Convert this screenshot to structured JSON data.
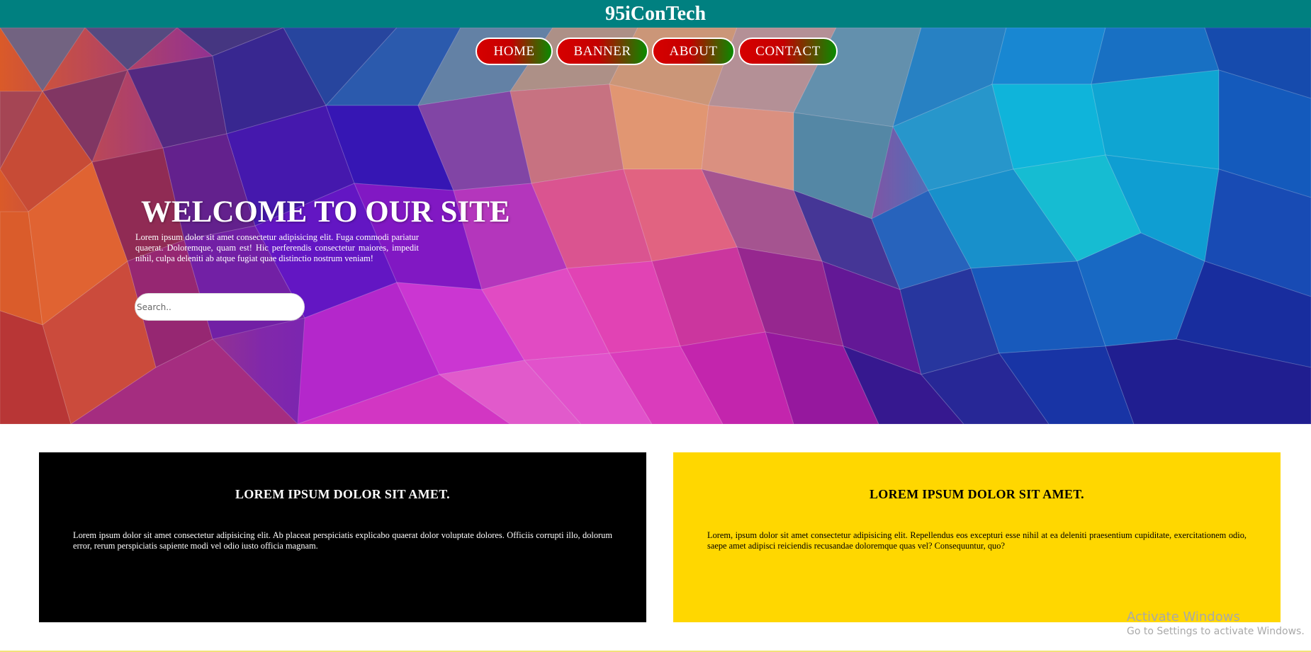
{
  "header": {
    "title": "95iConTech"
  },
  "nav": {
    "items": [
      {
        "label": "HOME"
      },
      {
        "label": "BANNER"
      },
      {
        "label": "ABOUT"
      },
      {
        "label": "CONTACT"
      }
    ]
  },
  "hero": {
    "heading": "WELCOME TO OUR SITE",
    "text": "Lorem ipsum dolor sit amet consectetur adipisicing elit. Fuga commodi pariatur quaerat. Doloremque, quam est! Hic perferendis consectetur maiores, impedit nihil, culpa deleniti ab atque fugiat quae distinctio nostrum veniam!",
    "search_placeholder": "Search.."
  },
  "cards": [
    {
      "title": "LOREM IPSUM DOLOR SIT AMET.",
      "text": "Lorem ipsum dolor sit amet consectetur adipisicing elit. Ab placeat perspiciatis explicabo quaerat dolor voluptate dolores. Officiis corrupti illo, dolorum error, rerum perspiciatis sapiente modi vel odio iusto officia magnam.",
      "background": "#000000"
    },
    {
      "title": "LOREM IPSUM DOLOR SIT AMET.",
      "text": "Lorem, ipsum dolor sit amet consectetur adipisicing elit. Repellendus eos excepturi esse nihil at ea deleniti praesentium cupiditate, exercitationem odio, saepe amet adipisci reiciendis recusandae doloremque quas vel? Consequuntur, quo?",
      "background": "#ffd700"
    }
  ],
  "watermark": {
    "line1": "Activate Windows",
    "line2": "Go to Settings to activate Windows."
  },
  "colors": {
    "topbar": "#008080",
    "nav_red": "#d60000",
    "nav_green": "#0a8a00",
    "accent_yellow": "#ffd700"
  }
}
